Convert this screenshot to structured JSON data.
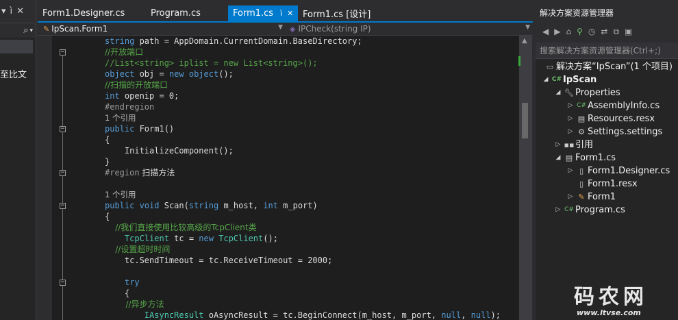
{
  "left_panel": {
    "header_pin": "ì",
    "header_close": "✕",
    "search_icon": "⌕",
    "visible_text": "至比文"
  },
  "tabs": [
    {
      "label": "Form1.Designer.cs",
      "active": false
    },
    {
      "label": "Program.cs",
      "active": false
    },
    {
      "label": "Form1.cs",
      "active": true,
      "pin": "ì",
      "close": "✕"
    },
    {
      "label": "Form1.cs [设计]",
      "active": false
    }
  ],
  "navbar": {
    "class_selector": "IpScan.Form1",
    "member_selector": "IPCheck(string IP)"
  },
  "solution_explorer": {
    "title": "解决方案资源管理器",
    "search_placeholder": "搜索解决方案资源管理器(Ctrl+;)",
    "items": [
      {
        "label": "解决方案“IpScan”(1 个项目)",
        "icon": "solution-icon",
        "bold": false
      },
      {
        "label": "IpScan",
        "icon": "csharp-project-icon",
        "bold": true
      },
      {
        "label": "Properties",
        "icon": "wrench-icon",
        "bold": false
      },
      {
        "label": "AssemblyInfo.cs",
        "icon": "csharp-file-icon",
        "bold": false
      },
      {
        "label": "Resources.resx",
        "icon": "resx-file-icon",
        "bold": false
      },
      {
        "label": "Settings.settings",
        "icon": "settings-gear-icon",
        "bold": false
      },
      {
        "label": "引用",
        "icon": "references-icon",
        "bold": false
      },
      {
        "label": "Form1.cs",
        "icon": "form-icon",
        "bold": false
      },
      {
        "label": "Form1.Designer.cs",
        "icon": "csharp-file-icon",
        "bold": false
      },
      {
        "label": "Form1.resx",
        "icon": "resx-file-icon",
        "bold": false
      },
      {
        "label": "Form1",
        "icon": "class-icon",
        "bold": false
      },
      {
        "label": "Program.cs",
        "icon": "csharp-file-icon",
        "bold": false
      }
    ]
  },
  "code": {
    "l0": [
      "string",
      " path = AppDomain.CurrentDomain.BaseDirectory;"
    ],
    "l1": "//开放端口",
    "l2": "//List<string> iplist = new List<string>();",
    "l3": [
      "object",
      " obj = ",
      "new",
      " ",
      "object",
      "();"
    ],
    "l4": "//扫描的开放端口",
    "l5": [
      "int",
      " openip = 0;"
    ],
    "l6": "#endregion",
    "l7": "1 个引用",
    "l8": [
      "public",
      " Form1()"
    ],
    "l9": "{",
    "l10": "    InitializeComponent();",
    "l11": "}",
    "l12": [
      "#region",
      " 扫描方法"
    ],
    "l14": "1 个引用",
    "l15": [
      "public",
      " ",
      "void",
      " Scan(",
      "string",
      " m_host, ",
      "int",
      " m_port)"
    ],
    "l16": "{",
    "l17": "    //我们直接使用比较高级的TcpClient类",
    "l18": [
      "    ",
      "TcpClient",
      " tc = ",
      "new",
      " ",
      "TcpClient",
      "();"
    ],
    "l19": "    //设置超时时间",
    "l20": "    tc.SendTimeout = tc.ReceiveTimeout = 2000;",
    "l22": [
      "    ",
      "try"
    ],
    "l23": "    {",
    "l24": "        //异步方法",
    "l25": [
      "        ",
      "IAsyncResult",
      " oAsyncResult = tc.BeginConnect(m_host, m_port, ",
      "null",
      ", ",
      "null",
      ");"
    ]
  },
  "watermark": {
    "big": "码农网",
    "small": "www.ltvse.com"
  },
  "colors": {
    "accent": "#007acc",
    "keyword": "#569cd6",
    "type": "#4ec9b0",
    "comment": "#57a64a",
    "string": "#d69d85",
    "editor_bg": "#1e1e1e"
  }
}
